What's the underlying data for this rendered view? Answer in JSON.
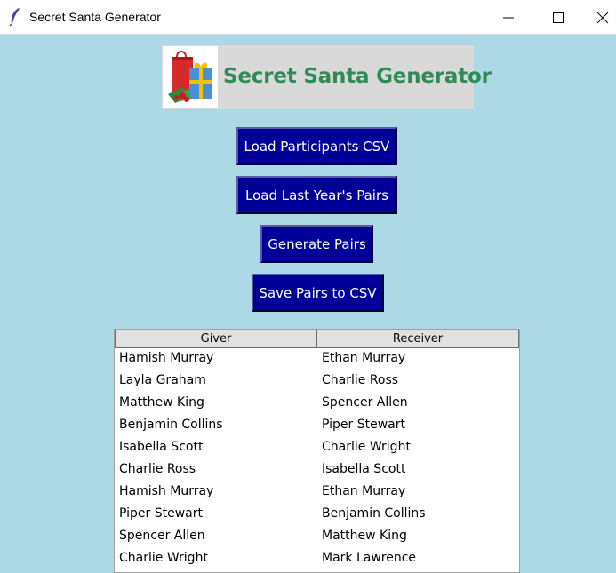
{
  "window": {
    "title": "Secret Santa Generator",
    "icon": "feather-icon"
  },
  "banner": {
    "title": "Secret Santa Generator",
    "image": "gift-bags-image",
    "title_color": "#2e8b57"
  },
  "buttons": {
    "load_participants": "Load Participants CSV",
    "load_last_year": "Load Last Year's Pairs",
    "generate": "Generate Pairs",
    "save": "Save Pairs to CSV"
  },
  "table": {
    "headers": [
      "Giver",
      "Receiver"
    ],
    "rows": [
      [
        "Hamish Murray",
        "Ethan Murray"
      ],
      [
        "Layla Graham",
        "Charlie Ross"
      ],
      [
        "Matthew King",
        "Spencer Allen"
      ],
      [
        "Benjamin Collins",
        "Piper Stewart"
      ],
      [
        "Isabella Scott",
        "Charlie Wright"
      ],
      [
        "Charlie Ross",
        "Isabella Scott"
      ],
      [
        "Hamish Murray",
        "Ethan Murray"
      ],
      [
        "Piper Stewart",
        "Benjamin Collins"
      ],
      [
        "Spencer Allen",
        "Matthew King"
      ],
      [
        "Charlie Wright",
        "Mark Lawrence"
      ]
    ]
  },
  "colors": {
    "background": "#add8e6",
    "button": "#000099",
    "button_text": "#ffffff"
  }
}
